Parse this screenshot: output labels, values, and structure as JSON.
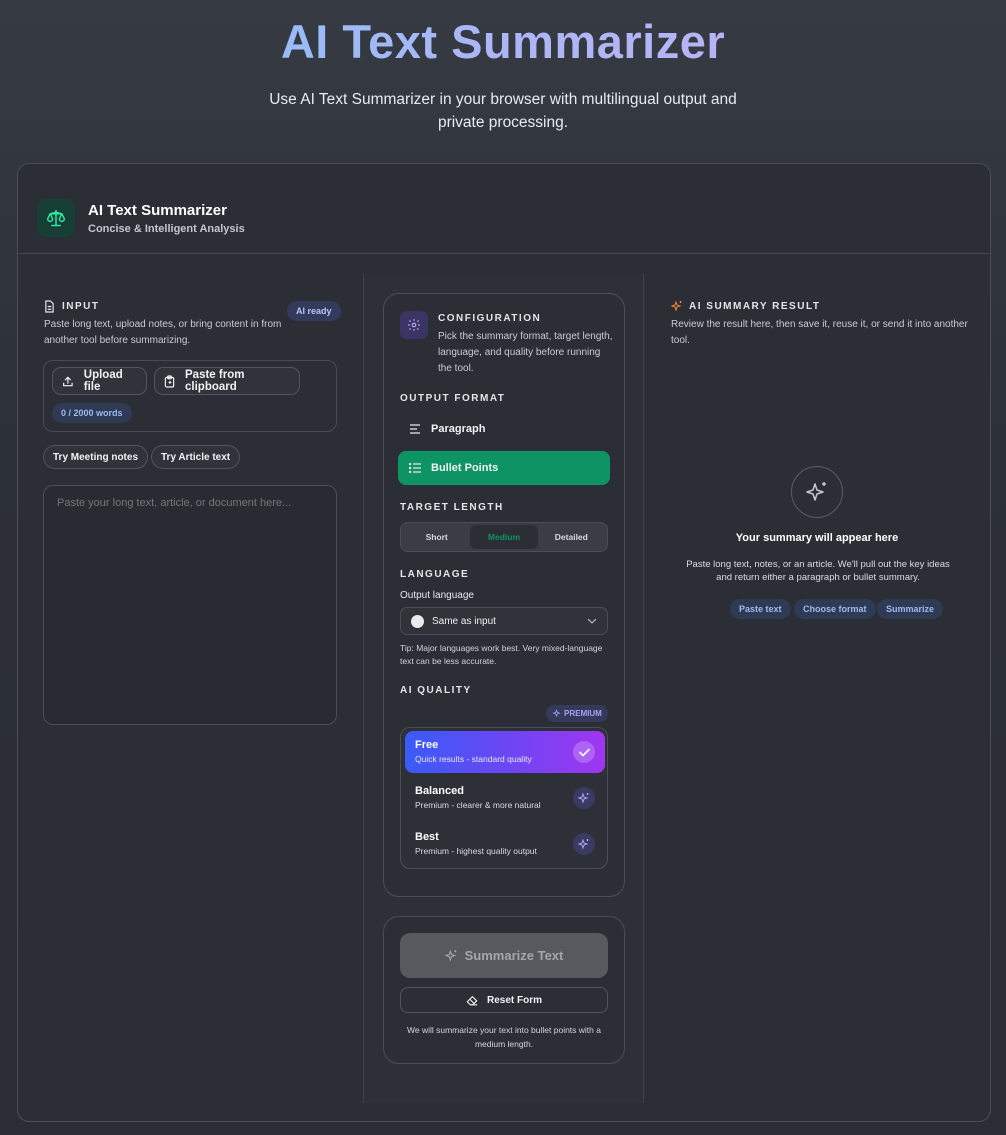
{
  "hero": {
    "title": "AI Text Summarizer",
    "subtitle": "Use AI Text Summarizer in your browser with multilingual output and private processing."
  },
  "app": {
    "title": "AI Text Summarizer",
    "subtitle": "Concise & Intelligent Analysis",
    "icon": "balance-scale-icon"
  },
  "input": {
    "label": "INPUT",
    "description": "Paste long text, upload notes, or bring content in from another tool before summarizing.",
    "status_badge": "AI ready",
    "upload_label": "Upload file",
    "paste_label": "Paste from clipboard",
    "word_count": "0 / 2000 words",
    "samples": [
      "Try Meeting notes",
      "Try Article text"
    ],
    "placeholder": "Paste your long text, article, or document here...",
    "value": ""
  },
  "config": {
    "label": "CONFIGURATION",
    "description": "Pick the summary format, target length, language, and quality before running the tool.",
    "output_format_label": "OUTPUT FORMAT",
    "formats": [
      "Paragraph",
      "Bullet Points"
    ],
    "selected_format": "Bullet Points",
    "target_length_label": "TARGET LENGTH",
    "lengths": [
      "Short",
      "Medium",
      "Detailed"
    ],
    "selected_length": "Medium",
    "language_label": "LANGUAGE",
    "output_language_label": "Output language",
    "language_value": "Same as input",
    "language_tip": "Tip: Major languages work best. Very mixed-language text can be less accurate.",
    "quality_label": "AI QUALITY",
    "premium_badge": "PREMIUM",
    "qualities": [
      {
        "name": "Free",
        "desc": "Quick results - standard quality"
      },
      {
        "name": "Balanced",
        "desc": "Premium - clearer & more natural"
      },
      {
        "name": "Best",
        "desc": "Premium - highest quality output"
      }
    ],
    "selected_quality": "Free"
  },
  "actions": {
    "summarize_label": "Summarize Text",
    "reset_label": "Reset Form",
    "hint": "We will summarize your text into bullet points with a medium length."
  },
  "result": {
    "label": "AI SUMMARY RESULT",
    "description": "Review the result here, then save it, reuse it, or send it into another tool.",
    "empty_title": "Your summary will appear here",
    "empty_desc": "Paste long text, notes, or an article. We'll pull out the key ideas and return either a paragraph or bullet summary.",
    "steps": [
      "Paste text",
      "Choose format",
      "Summarize"
    ]
  },
  "colors": {
    "accent_green": "#0e9464",
    "accent_blue": "#9db9f0",
    "premium_purple": "#8f7cf6",
    "orange_sparkle": "#f08a3c"
  }
}
